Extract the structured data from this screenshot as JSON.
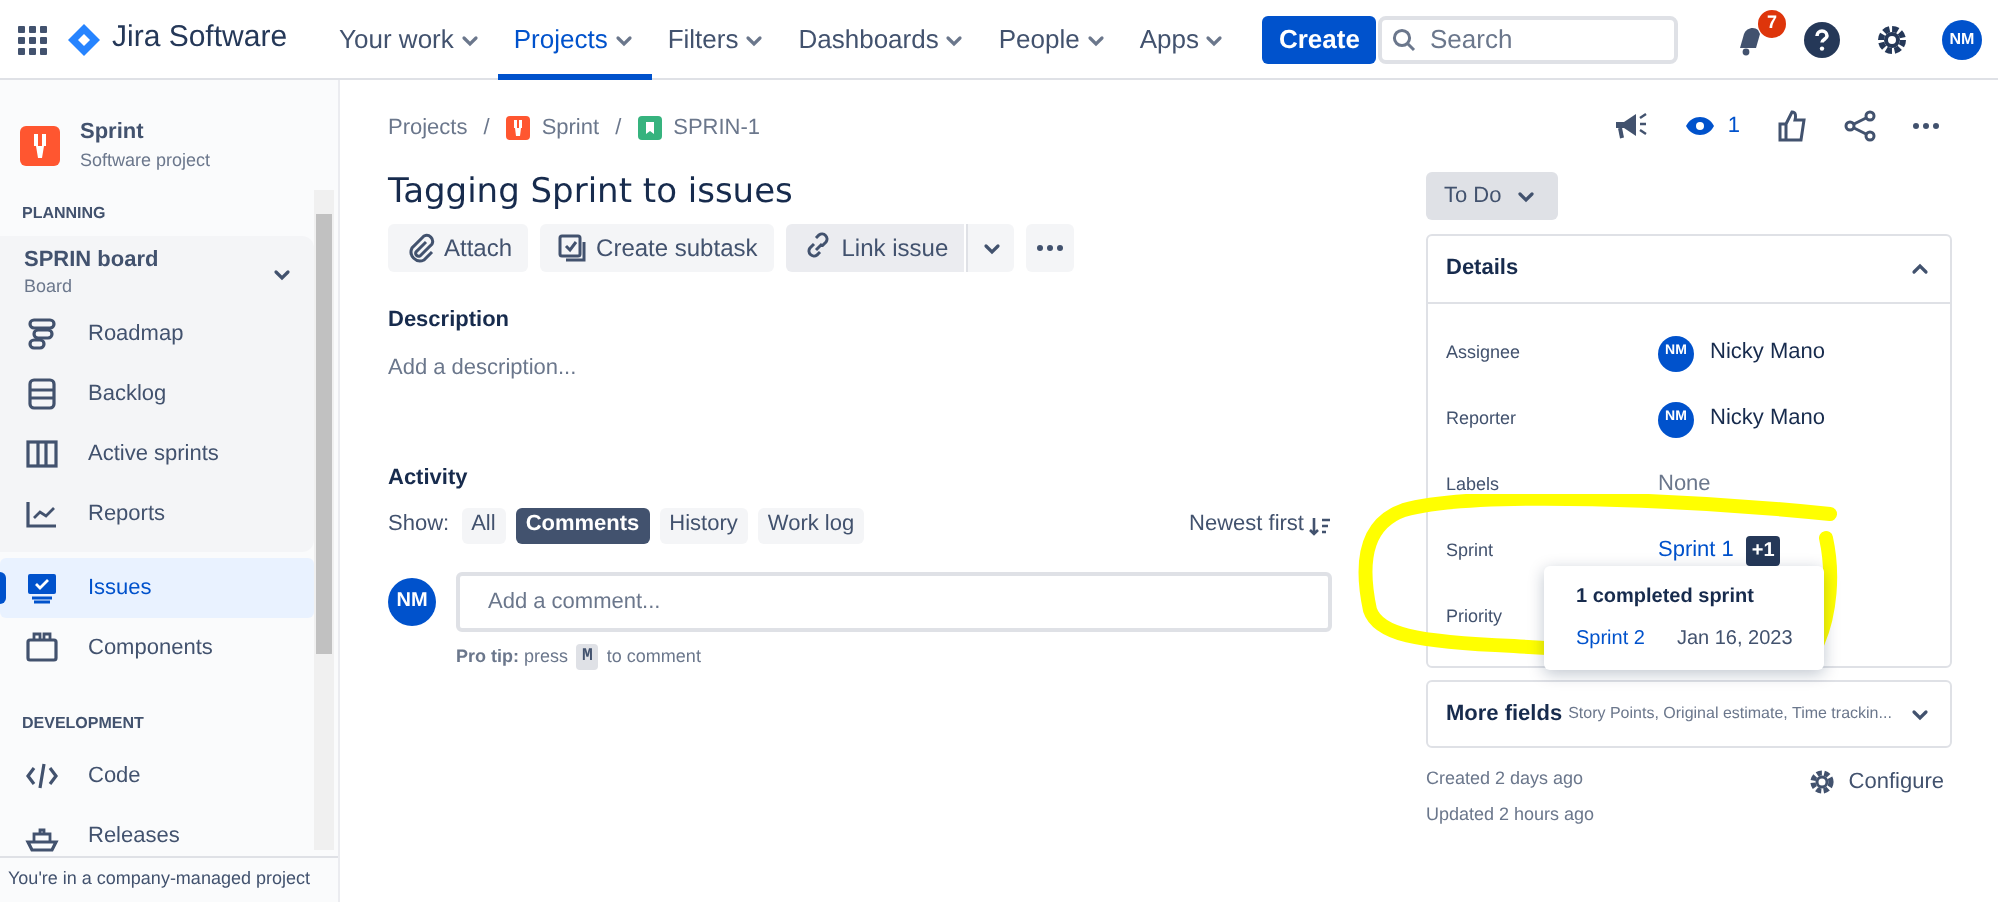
{
  "nav": {
    "product": "Jira Software",
    "items": [
      {
        "label": "Your work",
        "selected": false
      },
      {
        "label": "Projects",
        "selected": true
      },
      {
        "label": "Filters",
        "selected": false
      },
      {
        "label": "Dashboards",
        "selected": false
      },
      {
        "label": "People",
        "selected": false
      },
      {
        "label": "Apps",
        "selected": false
      }
    ],
    "create": "Create",
    "search": {
      "placeholder": "Search"
    },
    "notification_count": "7",
    "avatar": "NM"
  },
  "sidebar": {
    "project": {
      "name": "Sprint",
      "type": "Software project"
    },
    "sections": [
      {
        "heading": "PLANNING",
        "board": {
          "name": "SPRIN board",
          "subtitle": "Board",
          "expanded": true,
          "items": [
            {
              "label": "Roadmap",
              "selected": false
            },
            {
              "label": "Backlog",
              "selected": false
            },
            {
              "label": "Active sprints",
              "selected": false
            },
            {
              "label": "Reports",
              "selected": false
            }
          ]
        },
        "items": [
          {
            "label": "Issues",
            "selected": true
          },
          {
            "label": "Components",
            "selected": false
          }
        ]
      },
      {
        "heading": "DEVELOPMENT",
        "items": [
          {
            "label": "Code",
            "selected": false
          },
          {
            "label": "Releases",
            "selected": false
          }
        ]
      }
    ],
    "footer": "You're in a company-managed project"
  },
  "issue": {
    "breadcrumbs": [
      {
        "label": "Projects",
        "separator": "/"
      },
      {
        "label": "Sprint",
        "separator": "/"
      },
      {
        "label": "SPRIN-1"
      }
    ],
    "title": "Tagging Sprint to issues",
    "actions": [
      "Attach",
      "Create subtask",
      "Link issue"
    ],
    "description": {
      "heading": "Description",
      "placeholder": "Add a description..."
    },
    "activity": {
      "heading": "Activity",
      "show_label": "Show:",
      "filters": [
        {
          "label": "All",
          "selected": false
        },
        {
          "label": "Comments",
          "selected": true
        },
        {
          "label": "History",
          "selected": false
        },
        {
          "label": "Work log",
          "selected": false
        }
      ],
      "sort": "Newest first",
      "comment": {
        "avatar": "NM",
        "placeholder": "Add a comment..."
      },
      "pro_tip": "**Pro tip:** press",
      "pro_tip_key": "M",
      "pro_tip_end": "to comment"
    }
  },
  "side_panel": {
    "watchers": "1",
    "status": "To Do",
    "details": {
      "title": "Details",
      "expanded": true,
      "fields": [
        {
          "kind": "user",
          "label": "Assignee",
          "avatar": "NM",
          "value": "Nicky Mano"
        },
        {
          "kind": "user",
          "label": "Reporter",
          "avatar": "NM",
          "value": "Nicky Mano"
        },
        {
          "kind": "text",
          "label": "Labels",
          "value": "None"
        },
        {
          "kind": "sprint",
          "label": "Sprint",
          "value": "Sprint 1",
          "extra": "+1"
        },
        {
          "kind": "empty",
          "label": "Priority"
        }
      ]
    },
    "sprint_popover": {
      "title": "1 completed sprint",
      "rows": [
        {
          "sprint": "Sprint 2",
          "date": "Jan 16, 2023"
        }
      ]
    },
    "more_fields": {
      "label": "More fields",
      "summary": "Story Points, Original estimate, Time trackin..."
    },
    "created": "Created 2 days ago",
    "updated": "Updated 2 hours ago",
    "configure": "Configure"
  }
}
